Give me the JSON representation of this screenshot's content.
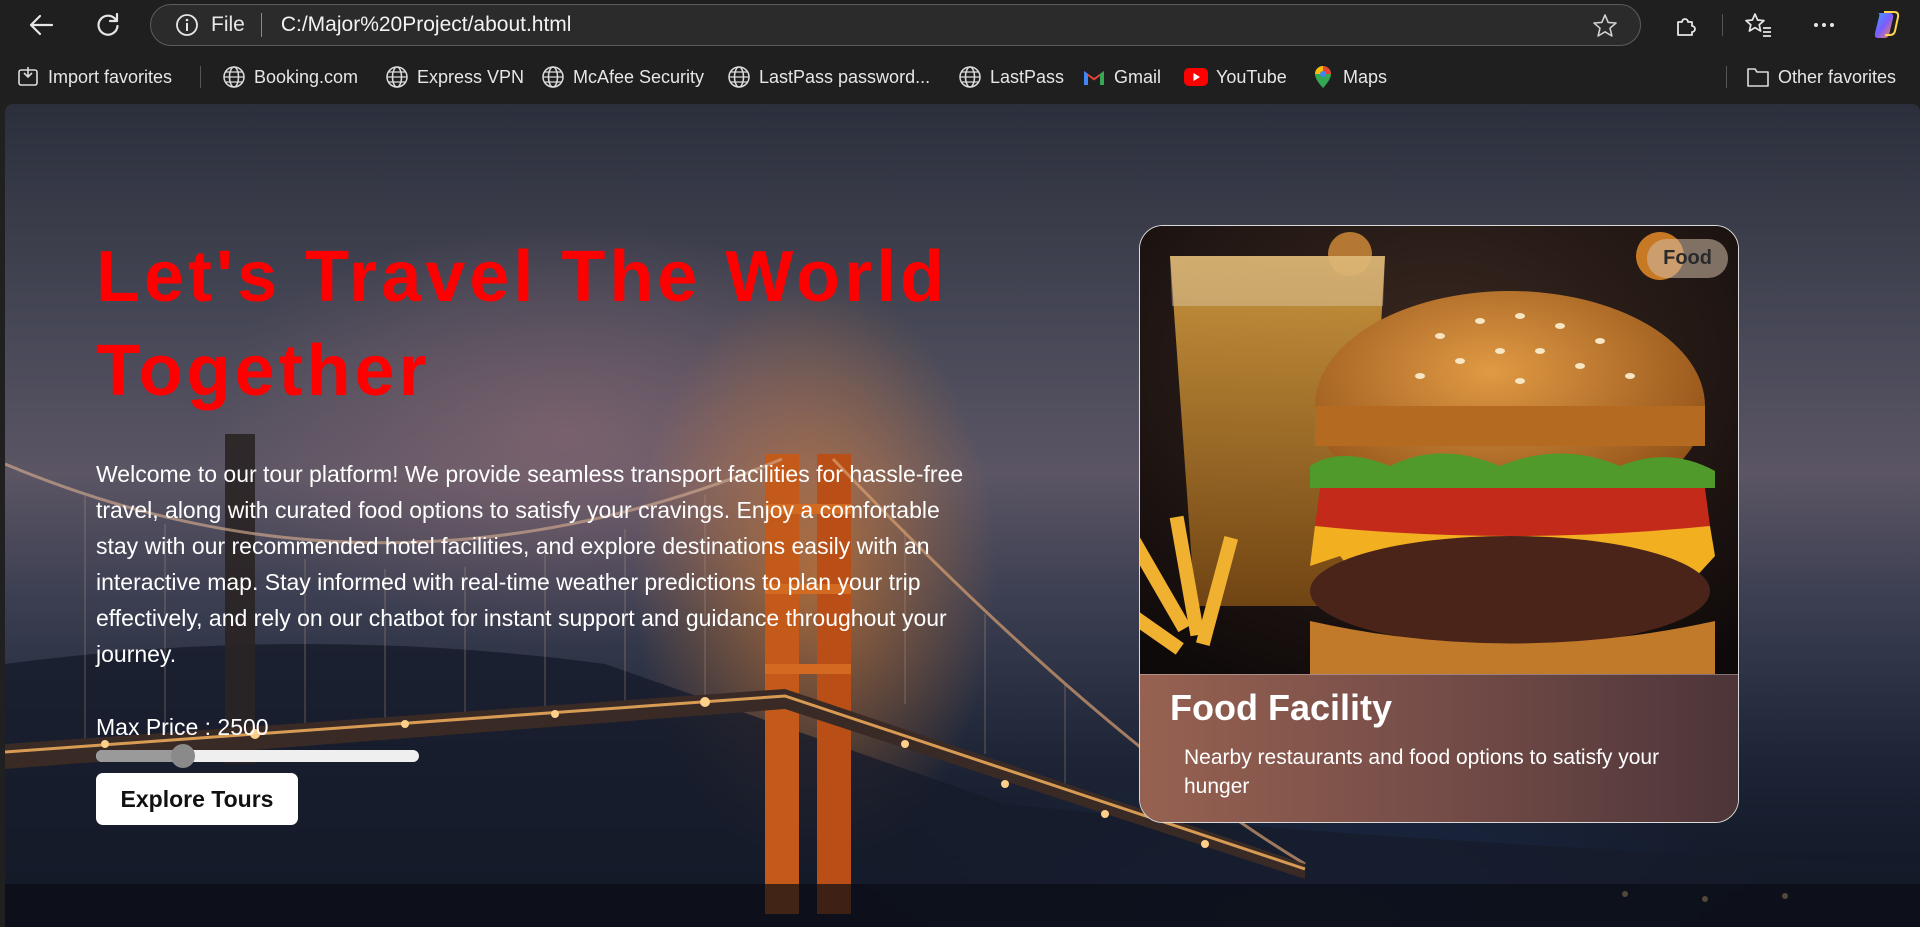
{
  "browser": {
    "address": {
      "file_label": "File",
      "url": "C:/Major%20Project/about.html"
    },
    "bookmarks": [
      {
        "label": "Import favorites",
        "icon": "import-icon"
      },
      {
        "label": "Booking.com",
        "icon": "globe-icon"
      },
      {
        "label": "Express VPN",
        "icon": "globe-icon"
      },
      {
        "label": "McAfee Security",
        "icon": "globe-icon"
      },
      {
        "label": "LastPass password...",
        "icon": "globe-icon"
      },
      {
        "label": "LastPass",
        "icon": "globe-icon"
      },
      {
        "label": "Gmail",
        "icon": "gmail-icon"
      },
      {
        "label": "YouTube",
        "icon": "youtube-icon"
      },
      {
        "label": "Maps",
        "icon": "maps-pin-icon"
      }
    ],
    "other_favorites": "Other favorites"
  },
  "hero": {
    "headline_line1": "Let's Travel The World",
    "headline_line2": "Together",
    "intro": "Welcome to our tour platform! We provide seamless transport facilities for hassle-free travel, along with curated food options to satisfy your cravings. Enjoy a comfortable stay with our recommended hotel facilities, and explore destinations easily with an interactive map. Stay informed with real-time weather predictions to plan your trip effectively, and rely on our chatbot for instant support and guidance throughout your journey.",
    "price_label": "Max Price : 2500",
    "price_slider_fraction": 0.27,
    "explore_button": "Explore Tours"
  },
  "card": {
    "badge": "Food",
    "title": "Food Facility",
    "description": "Nearby restaurants and food options to satisfy your hunger"
  },
  "colors": {
    "headline": "#ff0000",
    "chrome": "#1f1f1f"
  }
}
